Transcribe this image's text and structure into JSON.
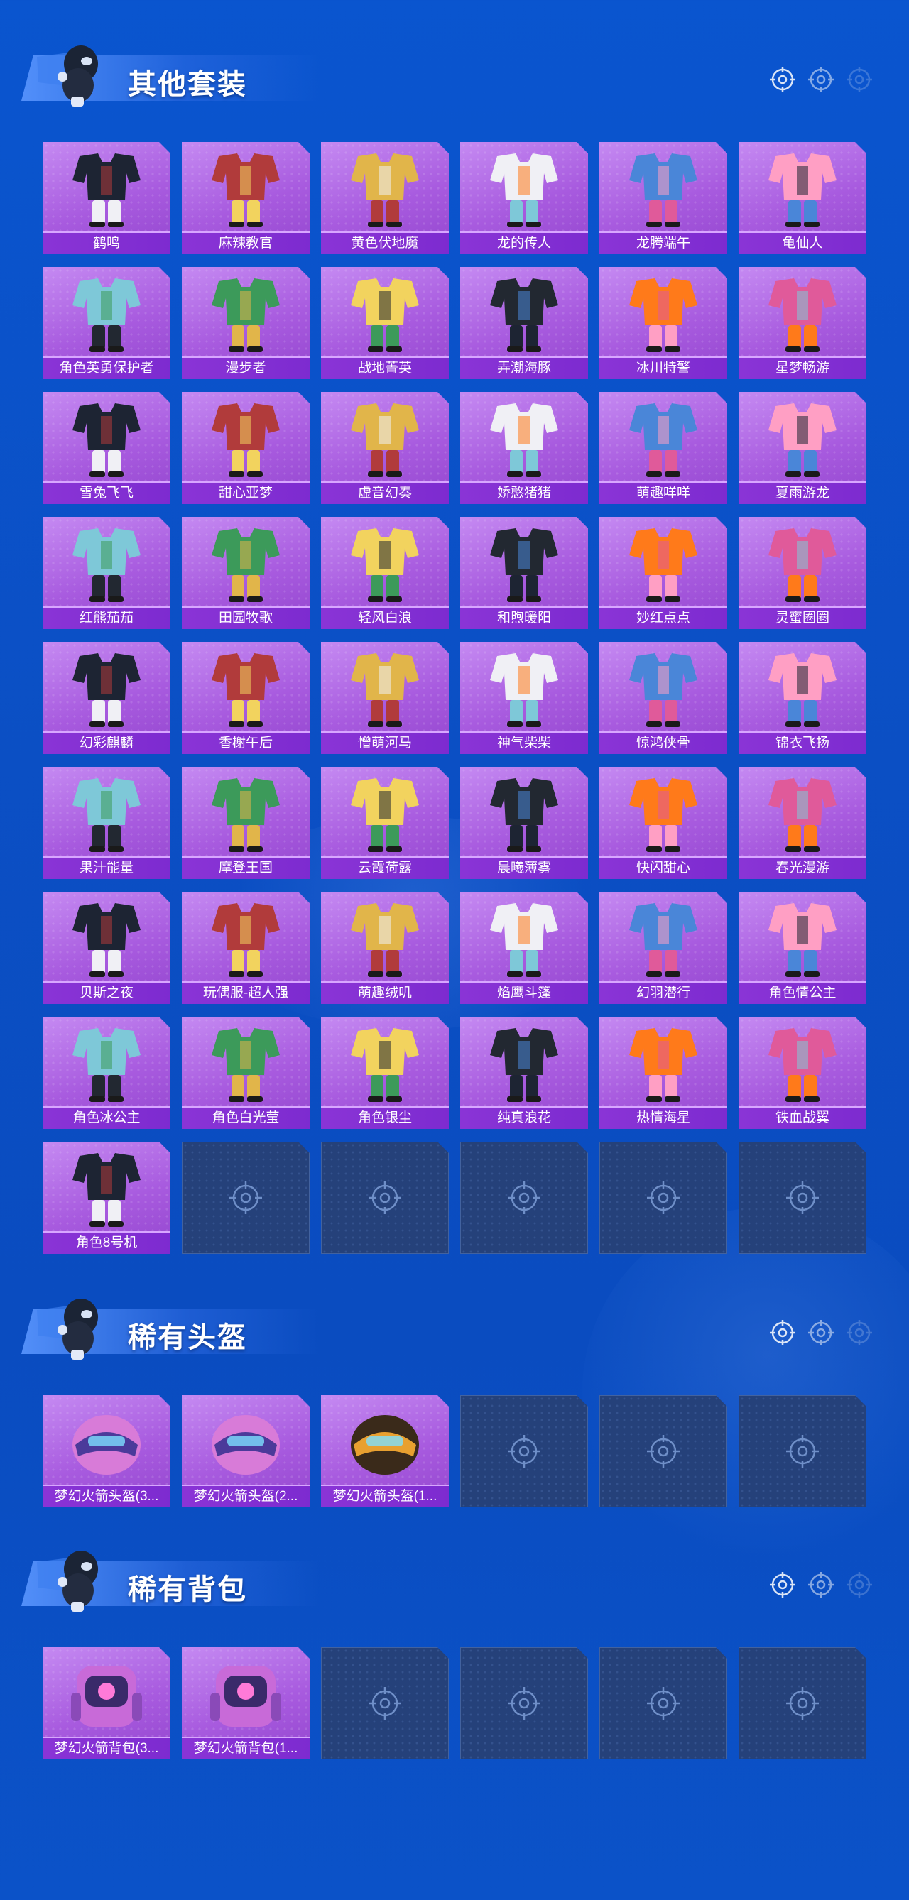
{
  "sections": {
    "suits": {
      "title": "其他套装",
      "items": [
        "鹤鸣",
        "麻辣教官",
        "黄色伏地魔",
        "龙的传人",
        "龙腾端午",
        "龟仙人",
        "角色英勇保护者",
        "漫步者",
        "战地菁英",
        "弄潮海豚",
        "冰川特警",
        "星梦畅游",
        "雪兔飞飞",
        "甜心亚梦",
        "虚音幻奏",
        "娇憨猪猪",
        "萌趣咩咩",
        "夏雨游龙",
        "红熊茄茄",
        "田园牧歌",
        "轻风白浪",
        "和煦暖阳",
        "妙红点点",
        "灵蜜圈圈",
        "幻彩麒麟",
        "香榭午后",
        "憎萌河马",
        "神气柴柴",
        "惊鸿侠骨",
        "锦衣飞扬",
        "果汁能量",
        "摩登王国",
        "云霞荷露",
        "晨曦薄雾",
        "快闪甜心",
        "春光漫游",
        "贝斯之夜",
        "玩偶服-超人强",
        "萌趣绒叽",
        "焰鹰斗篷",
        "幻羽潜行",
        "角色情公主",
        "角色冰公主",
        "角色白光莹",
        "角色银尘",
        "纯真浪花",
        "热情海星",
        "铁血战翼",
        "角色8号机"
      ]
    },
    "helmets": {
      "title": "稀有头盔",
      "items": [
        "梦幻火箭头盔(3...",
        "梦幻火箭头盔(2...",
        "梦幻火箭头盔(1..."
      ]
    },
    "backpacks": {
      "title": "稀有背包",
      "items": [
        "梦幻火箭背包(3...",
        "梦幻火箭背包(1..."
      ]
    }
  },
  "colors": {
    "background": "#0a50c8",
    "card": "#a85bdf",
    "label_bar": "#8a34d6",
    "empty_slot": "#25417a"
  },
  "icons": {
    "header_mascot": "mascot-icon",
    "empty_slot": "crosshair-icon",
    "header_deco": "crosshair-icon"
  }
}
